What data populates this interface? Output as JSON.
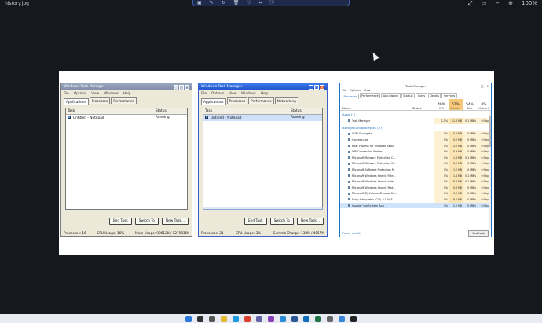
{
  "viewer": {
    "file_name": "_history.jpg",
    "zoom": "100%",
    "toolbar_icons": [
      "image-icon",
      "edit-icon",
      "rotate-icon",
      "delete-icon",
      "favorite-icon",
      "crop-icon",
      "info-icon"
    ]
  },
  "xp_tm1": {
    "title": "Windows Task Manager",
    "menu": [
      "File",
      "Options",
      "View",
      "Windows",
      "Help"
    ],
    "tabs": [
      "Applications",
      "Processes",
      "Performance"
    ],
    "columns": {
      "task": "Task",
      "status": "Status"
    },
    "rows": [
      {
        "task": "Untitled - Notepad",
        "status": "Running"
      }
    ],
    "buttons": {
      "end": "End Task",
      "switch": "Switch To",
      "new": "New Task..."
    },
    "status": {
      "processes": "Processes: 16",
      "cpu": "CPU Usage: 16%",
      "mem": "Mem Usage: 90612K / 1279036K"
    }
  },
  "xp_tm2": {
    "title": "Windows Task Manager",
    "menu": [
      "File",
      "Options",
      "View",
      "Windows",
      "Help"
    ],
    "tabs": [
      "Applications",
      "Processes",
      "Performance",
      "Networking"
    ],
    "columns": {
      "task": "Task",
      "status": "Status"
    },
    "rows": [
      {
        "task": "Untitled - Notepad",
        "status": "Running"
      }
    ],
    "buttons": {
      "end": "End Task",
      "switch": "Switch To",
      "new": "New Task..."
    },
    "status": {
      "processes": "Processes: 21",
      "cpu": "CPU Usage: 3%",
      "commit": "Commit Charge: 138M / 4057M"
    }
  },
  "w10_tm": {
    "title": "Task Manager",
    "menu": [
      "File",
      "Options",
      "View"
    ],
    "tabs": [
      "Processes",
      "Performance",
      "App history",
      "Startup",
      "Users",
      "Details",
      "Services"
    ],
    "headers": {
      "name": "Name",
      "status": "Status",
      "cpu": {
        "pct": "40%",
        "label": "CPU"
      },
      "memory": {
        "pct": "67%",
        "label": "Memory"
      },
      "disk": {
        "pct": "54%",
        "label": "Disk"
      },
      "network": {
        "pct": "0%",
        "label": "Network"
      }
    },
    "apps_group": "Apps (1)",
    "apps": [
      {
        "name": "Task Manager",
        "cpu": "1.1%",
        "mem": "11.6 MB",
        "disk": "0.1 MB/s",
        "net": "0 Mbps"
      }
    ],
    "bg_group": "Background processes (27)",
    "background": [
      {
        "name": "COM Surrogate",
        "cpu": "0%",
        "mem": "0.6 MB",
        "disk": "0 MB/s",
        "net": "0 Mbps"
      },
      {
        "name": "Cypress.exe",
        "cpu": "0%",
        "mem": "0.2 MB",
        "disk": "0 MB/s",
        "net": "0 Mbps"
      },
      {
        "name": "Host Process for Windows Tasks",
        "cpu": "0%",
        "mem": "2.0 MB",
        "disk": "0 MB/s",
        "net": "0 Mbps"
      },
      {
        "name": "IME Connection Broker",
        "cpu": "0%",
        "mem": "0.9 MB",
        "disk": "0 MB/s",
        "net": "0 Mbps"
      },
      {
        "name": "Microsoft Malware Protection C...",
        "cpu": "0%",
        "mem": "1.6 MB",
        "disk": "0.1 MB/s",
        "net": "0 Mbps"
      },
      {
        "name": "Microsoft Malware Protection C...",
        "cpu": "0%",
        "mem": "0.5 MB",
        "disk": "0 MB/s",
        "net": "0 Mbps"
      },
      {
        "name": "Microsoft Software Protection P...",
        "cpu": "0%",
        "mem": "1.2 MB",
        "disk": "0 MB/s",
        "net": "0 Mbps"
      },
      {
        "name": "Microsoft Windows Search Filte...",
        "cpu": "0%",
        "mem": "1.4 MB",
        "disk": "0.1 MB/s",
        "net": "0 Mbps"
      },
      {
        "name": "Microsoft Windows Search Inde...",
        "cpu": "0%",
        "mem": "6.8 MB",
        "disk": "0.1 MB/s",
        "net": "0 Mbps"
      },
      {
        "name": "Microsoft Windows Search Prot...",
        "cpu": "0%",
        "mem": "0.6 MB",
        "disk": "0 MB/s",
        "net": "0 Mbps"
      },
      {
        "name": "Microsoft(R) Volume Shadow Co...",
        "cpu": "0%",
        "mem": "1.0 MB",
        "disk": "0 MB/s",
        "net": "0 Mbps"
      },
      {
        "name": "Ruby Interpreter (CUI) 2.0.0p3...",
        "cpu": "0%",
        "mem": "9.0 MB",
        "disk": "0 MB/s",
        "net": "0 Mbps"
      },
      {
        "name": "Spooler SubSystem App",
        "cpu": "0%",
        "mem": "2.0 MB",
        "disk": "0 MB/s",
        "net": "0 Mbps"
      }
    ],
    "fewer_details": "Fewer details",
    "end_task": "End task"
  },
  "colors": {
    "desktop": "#15181d",
    "win10_accent": "#1f6fc2",
    "metric_hot": "#f7c87a"
  },
  "taskbar_icons": [
    {
      "name": "start-icon",
      "color": "#2b78d8"
    },
    {
      "name": "search-icon",
      "color": "#333333"
    },
    {
      "name": "task-view-icon",
      "color": "#555555"
    },
    {
      "name": "file-explorer-icon",
      "color": "#e5b630"
    },
    {
      "name": "edge-icon",
      "color": "#1a9be0"
    },
    {
      "name": "chrome-icon",
      "color": "#d8402f"
    },
    {
      "name": "teams-icon",
      "color": "#6264a7"
    },
    {
      "name": "onenote-icon",
      "color": "#8a3eb8"
    },
    {
      "name": "photos-icon",
      "color": "#2a8bd6"
    },
    {
      "name": "word-icon",
      "color": "#2b5797"
    },
    {
      "name": "outlook-icon",
      "color": "#0f6cbd"
    },
    {
      "name": "excel-icon",
      "color": "#217346"
    },
    {
      "name": "settings-icon",
      "color": "#666666"
    },
    {
      "name": "store-icon",
      "color": "#3a86d6"
    },
    {
      "name": "terminal-icon",
      "color": "#222222"
    }
  ]
}
